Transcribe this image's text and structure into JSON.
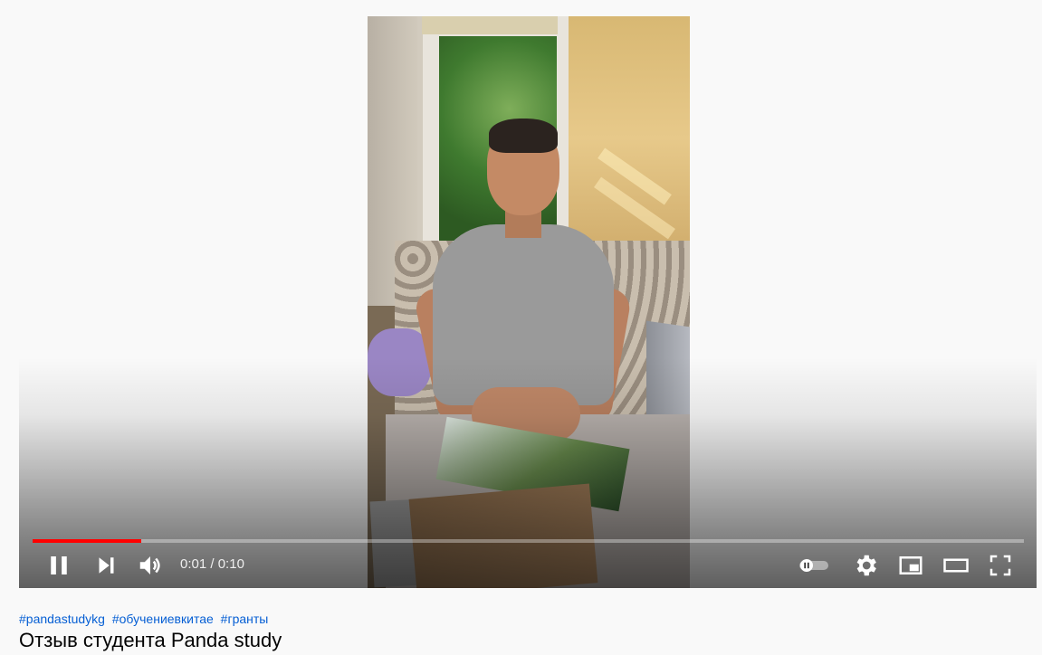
{
  "player": {
    "time_current": "0:01",
    "time_separator": " / ",
    "time_total": "0:10",
    "progress_played_fraction": 0.11,
    "progress_loaded_fraction": 0.11,
    "is_playing": true,
    "autoplay_on": false,
    "controls": {
      "left": [
        "pause-icon",
        "next-icon",
        "volume-icon"
      ],
      "right": [
        "autoplay-toggle",
        "settings-icon",
        "miniplayer-icon",
        "theater-mode-icon",
        "fullscreen-icon"
      ]
    },
    "accent_color": "#ff0000"
  },
  "video": {
    "hashtags": [
      "#pandastudykg",
      "#обучениевкитае",
      "#гранты"
    ],
    "title": "Отзыв студента Panda study",
    "link_color": "#065fd4"
  }
}
